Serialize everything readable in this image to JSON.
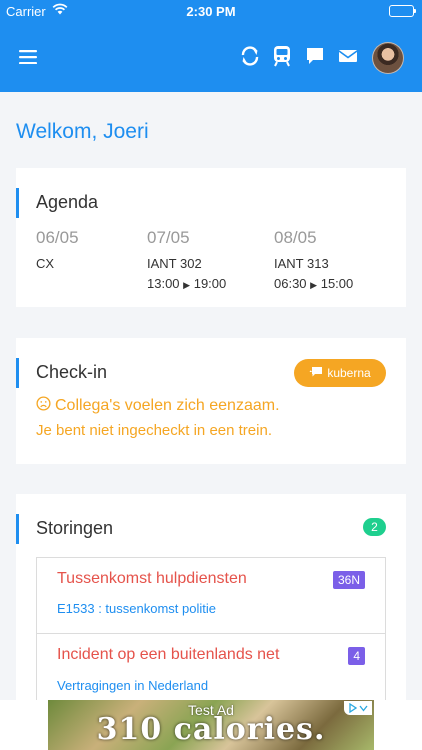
{
  "status_bar": {
    "carrier": "Carrier",
    "time": "2:30 PM"
  },
  "nav": {
    "icons": [
      "menu-icon",
      "refresh-icon",
      "train-icon",
      "chat-icon",
      "mail-icon",
      "avatar"
    ]
  },
  "welcome": "Welkom, Joeri",
  "agenda": {
    "title": "Agenda",
    "days": [
      {
        "date": "06/05",
        "label": "CX",
        "time_from": "",
        "time_to": ""
      },
      {
        "date": "07/05",
        "label": "IANT 302",
        "time_from": "13:00",
        "time_to": "19:00"
      },
      {
        "date": "08/05",
        "label": "IANT 313",
        "time_from": "06:30",
        "time_to": "15:00"
      }
    ]
  },
  "checkin": {
    "title": "Check-in",
    "button": "kuberna",
    "message": "Collega's voelen zich eenzaam.",
    "status": "Je bent niet ingecheckt in een trein."
  },
  "storingen": {
    "title": "Storingen",
    "count": "2",
    "items": [
      {
        "title": "Tussenkomst hulpdiensten",
        "tag": "36N",
        "sub": "E1533 : tussenkomst politie"
      },
      {
        "title": "Incident op een buitenlands net",
        "tag": "4",
        "sub": "Vertragingen in Nederland"
      }
    ]
  },
  "ad": {
    "label": "Test Ad",
    "text": "310 calories."
  },
  "colors": {
    "primary": "#1e8ef0",
    "warning": "#f5a623",
    "danger": "#e5534b",
    "success": "#1ecf8e",
    "tag": "#7b5fe8"
  }
}
